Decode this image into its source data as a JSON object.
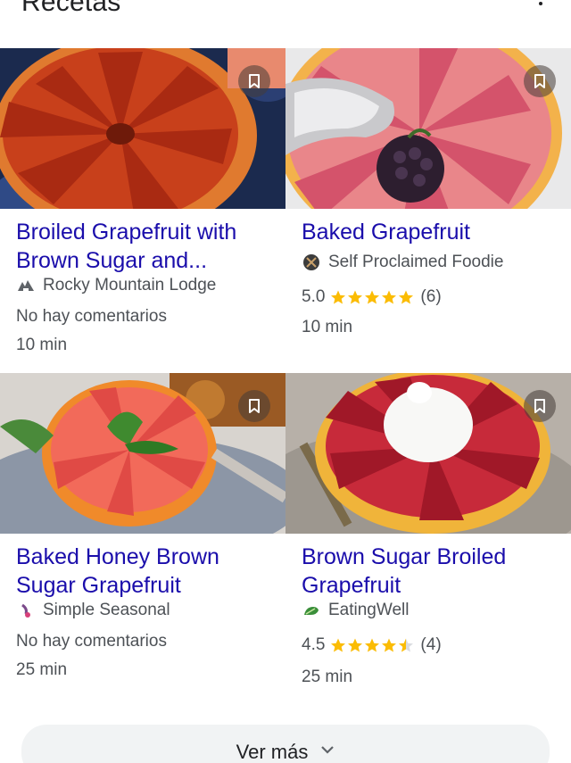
{
  "header": {
    "title": "Recetas"
  },
  "recipes": [
    {
      "title": "Broiled Grapefruit with Brown Sugar and...",
      "source": "Rocky Mountain Lodge",
      "comments": "No hay comentarios",
      "time": "10 min",
      "source_icon": "lodge-logo-icon"
    },
    {
      "title": "Baked Grapefruit",
      "source": "Self Proclaimed Foodie",
      "rating": "5.0",
      "stars": 5,
      "review_count": "(6)",
      "time": "10 min",
      "source_icon": "foodie-logo-icon"
    },
    {
      "title": "Baked Honey Brown Sugar Grapefruit",
      "source": "Simple Seasonal",
      "comments": "No hay comentarios",
      "time": "25 min",
      "source_icon": "seasonal-logo-icon"
    },
    {
      "title": "Brown Sugar Broiled Grapefruit",
      "source": "EatingWell",
      "rating": "4.5",
      "stars": 4.5,
      "review_count": "(4)",
      "time": "25 min",
      "source_icon": "eatingwell-logo-icon"
    }
  ],
  "see_more": {
    "label": "Ver más"
  },
  "colors": {
    "link": "#1a0dab",
    "star": "#fbbc04",
    "meta": "#4d5156"
  }
}
